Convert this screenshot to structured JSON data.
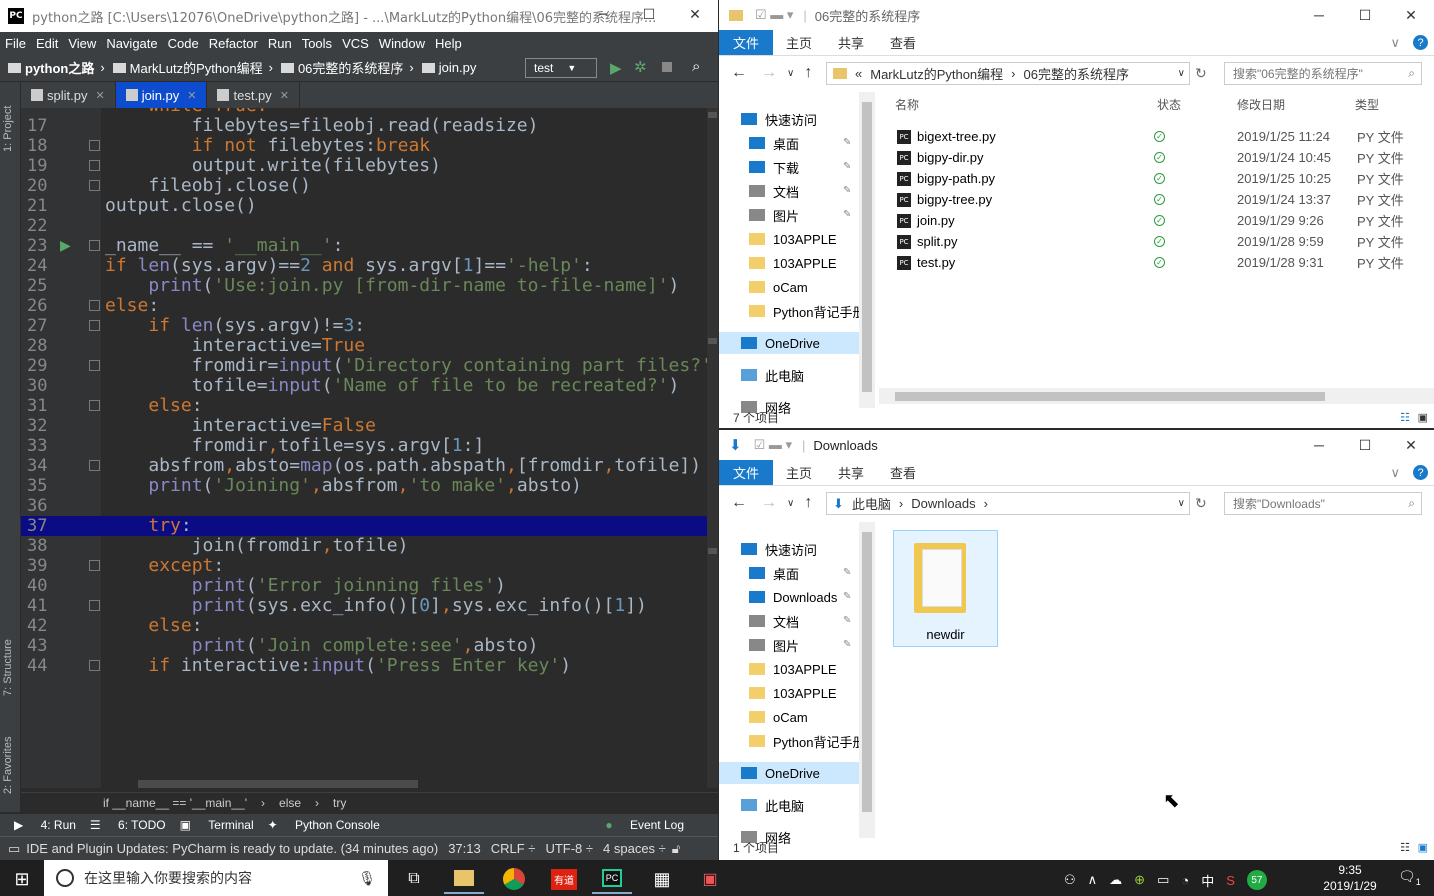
{
  "ide": {
    "title": "python之路 [C:\\Users\\12076\\OneDrive\\python之路] - ...\\MarkLutz的Python编程\\06完整的系统程序...",
    "logo": "PC",
    "menu": [
      "File",
      "Edit",
      "View",
      "Navigate",
      "Code",
      "Refactor",
      "Run",
      "Tools",
      "VCS",
      "Window",
      "Help"
    ],
    "nav": [
      "python之路",
      "MarkLutz的Python编程",
      "06完整的系统程序",
      "join.py"
    ],
    "run_config": "test",
    "tabs": [
      {
        "label": "split.py"
      },
      {
        "label": "join.py"
      },
      {
        "label": "test.py"
      }
    ],
    "side_tabs": [
      "1: Project",
      "7: Structure",
      "2: Favorites"
    ],
    "lines": [
      {
        "n": "17",
        "html": "        filebytes=fileobj.read(readsize)"
      },
      {
        "n": "18",
        "html": "        <span class='kw'>if not</span> filebytes:<span class='kw'>break</span>"
      },
      {
        "n": "19",
        "html": "        output.write(filebytes)"
      },
      {
        "n": "20",
        "html": "    fileobj.close()"
      },
      {
        "n": "21",
        "html": "output.close()"
      },
      {
        "n": "22",
        "html": ""
      },
      {
        "n": "23",
        "html": "_name__ == <span class='str'>'__main__'</span>:"
      },
      {
        "n": "24",
        "html": "<span class='kw'>if</span> <span class='bi'>len</span>(sys.argv)==<span class='num'>2</span> <span class='kw'>and</span> sys.argv[<span class='num'>1</span>]==<span class='str'>'-help'</span>:"
      },
      {
        "n": "25",
        "html": "    <span class='bi'>print</span>(<span class='str'>'Use:join.py [from-dir-name to-file-name]'</span>)"
      },
      {
        "n": "26",
        "html": "<span class='kw'>else</span>:"
      },
      {
        "n": "27",
        "html": "    <span class='kw'>if</span> <span class='bi'>len</span>(sys.argv)!=<span class='num'>3</span>:"
      },
      {
        "n": "28",
        "html": "        interactive=<span class='kw'>True</span>"
      },
      {
        "n": "29",
        "html": "        fromdir=<span class='bi'>input</span>(<span class='str'>'Directory containing part files?'</span>"
      },
      {
        "n": "30",
        "html": "        tofile=<span class='bi'>input</span>(<span class='str'>'Name of file to be recreated?'</span>)"
      },
      {
        "n": "31",
        "html": "    <span class='kw'>else</span>:"
      },
      {
        "n": "32",
        "html": "        interactive=<span class='kw'>False</span>"
      },
      {
        "n": "33",
        "html": "        fromdir<span class='kw'>,</span>tofile=sys.argv[<span class='num'>1</span>:]"
      },
      {
        "n": "34",
        "html": "    absfrom<span class='kw'>,</span>absto=<span class='bi'>map</span>(os.path.abspath<span class='kw'>,</span>[fromdir<span class='kw'>,</span>tofile])"
      },
      {
        "n": "35",
        "html": "    <span class='bi'>print</span>(<span class='str'>'Joining'</span><span class='kw'>,</span>absfrom<span class='kw'>,</span><span class='str'>'to make'</span><span class='kw'>,</span>absto)"
      },
      {
        "n": "36",
        "html": ""
      },
      {
        "n": "37",
        "html": "    <span class='kw'>try</span>:"
      },
      {
        "n": "38",
        "html": "        join(fromdir<span class='kw'>,</span>tofile)"
      },
      {
        "n": "39",
        "html": "    <span class='kw'>except</span>:"
      },
      {
        "n": "40",
        "html": "        <span class='bi'>print</span>(<span class='str'>'Error joinning files'</span>)"
      },
      {
        "n": "41",
        "html": "        <span class='bi'>print</span>(sys.exc_info()[<span class='num'>0</span>]<span class='kw'>,</span>sys.exc_info()[<span class='num'>1</span>])"
      },
      {
        "n": "42",
        "html": "    <span class='kw'>else</span>:"
      },
      {
        "n": "43",
        "html": "        <span class='bi'>print</span>(<span class='str'>'Join complete:see'</span><span class='kw'>,</span>absto)"
      },
      {
        "n": "44",
        "html": "    <span class='kw'>if</span> interactive:<span class='bi'>input</span>(<span class='str'>'Press Enter key'</span>)"
      }
    ],
    "highlight_line": "37",
    "breadcrumbs": [
      "if __name__ == '__main__'",
      "else",
      "try"
    ],
    "tool_windows": [
      "4: Run",
      "6: TODO",
      "Terminal",
      "Python Console",
      "Event Log"
    ],
    "status": {
      "message": "IDE and Plugin Updates: PyCharm is ready to update. (34 minutes ago)",
      "pos": "37:13",
      "crlf": "CRLF ÷",
      "enc": "UTF-8 ÷",
      "indent": "4 spaces ÷"
    }
  },
  "exp1": {
    "title": "06完整的系统程序",
    "ribbon": [
      "文件",
      "主页",
      "共享",
      "查看"
    ],
    "path": [
      "«",
      "MarkLutz的Python编程",
      "›",
      "06完整的系统程序"
    ],
    "search": "搜索\"06完整的系统程序\"",
    "cols": {
      "name": "名称",
      "status": "状态",
      "date": "修改日期",
      "type": "类型"
    },
    "nav": [
      {
        "label": "快速访问",
        "pin": false
      },
      {
        "label": "桌面",
        "pin": true
      },
      {
        "label": "下载",
        "pin": true
      },
      {
        "label": "文档",
        "pin": true
      },
      {
        "label": "图片",
        "pin": true
      },
      {
        "label": "103APPLE",
        "pin": false
      },
      {
        "label": "103APPLE",
        "pin": false
      },
      {
        "label": "oCam",
        "pin": false
      },
      {
        "label": "Python背记手册",
        "pin": false
      },
      {
        "label": "OneDrive",
        "pin": false
      },
      {
        "label": "此电脑",
        "pin": false
      },
      {
        "label": "网络",
        "pin": false
      }
    ],
    "files": [
      {
        "name": "bigext-tree.py",
        "date": "2019/1/25 11:24",
        "type": "PY 文件"
      },
      {
        "name": "bigpy-dir.py",
        "date": "2019/1/24 10:45",
        "type": "PY 文件"
      },
      {
        "name": "bigpy-path.py",
        "date": "2019/1/25 10:25",
        "type": "PY 文件"
      },
      {
        "name": "bigpy-tree.py",
        "date": "2019/1/24 13:37",
        "type": "PY 文件"
      },
      {
        "name": "join.py",
        "date": "2019/1/29 9:26",
        "type": "PY 文件"
      },
      {
        "name": "split.py",
        "date": "2019/1/28 9:59",
        "type": "PY 文件"
      },
      {
        "name": "test.py",
        "date": "2019/1/28 9:31",
        "type": "PY 文件"
      }
    ],
    "count": "7 个项目"
  },
  "exp2": {
    "title": "Downloads",
    "ribbon": [
      "文件",
      "主页",
      "共享",
      "查看"
    ],
    "path": [
      "此电脑",
      "›",
      "Downloads",
      "›"
    ],
    "search": "搜索\"Downloads\"",
    "nav": [
      {
        "label": "快速访问",
        "pin": false
      },
      {
        "label": "桌面",
        "pin": true
      },
      {
        "label": "Downloads",
        "pin": true
      },
      {
        "label": "文档",
        "pin": true
      },
      {
        "label": "图片",
        "pin": true
      },
      {
        "label": "103APPLE",
        "pin": false
      },
      {
        "label": "103APPLE",
        "pin": false
      },
      {
        "label": "oCam",
        "pin": false
      },
      {
        "label": "Python背记手册",
        "pin": false
      },
      {
        "label": "OneDrive",
        "pin": false
      },
      {
        "label": "此电脑",
        "pin": false
      },
      {
        "label": "网络",
        "pin": false
      }
    ],
    "folder": "newdir",
    "count": "1 个项目"
  },
  "taskbar": {
    "search": "在这里输入你要搜索的内容",
    "time": "9:35",
    "date": "2019/1/29",
    "ime": "中",
    "badge": "57",
    "notif": "1",
    "app_youdao": "有道",
    "app_pc": "PC"
  },
  "colors": {
    "accent": "#1979ca",
    "ide_bg": "#2b2b2b",
    "highlight": "#0b0b84"
  }
}
